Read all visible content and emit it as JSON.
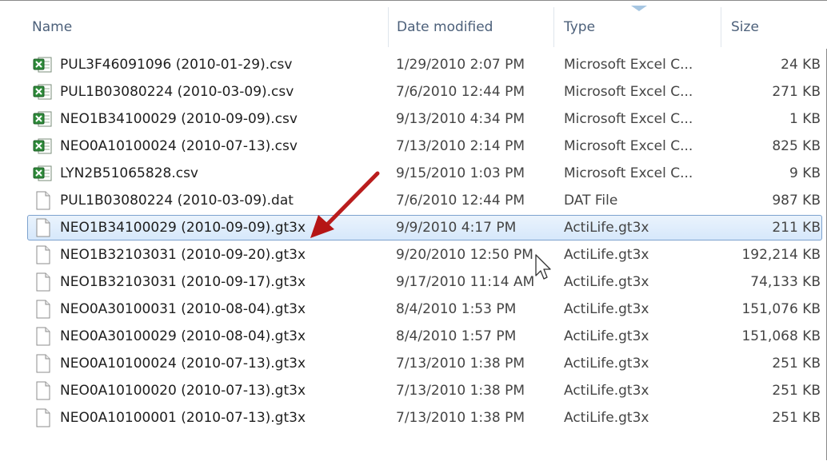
{
  "columns": {
    "name": "Name",
    "date": "Date modified",
    "type": "Type",
    "size": "Size"
  },
  "files": [
    {
      "name": "PUL3F46091096 (2010-01-29).csv",
      "date": "1/29/2010 2:07 PM",
      "type": "Microsoft Excel C...",
      "size": "24 KB",
      "icon": "excel-csv-icon"
    },
    {
      "name": "PUL1B03080224 (2010-03-09).csv",
      "date": "7/6/2010 12:44 PM",
      "type": "Microsoft Excel C...",
      "size": "271 KB",
      "icon": "excel-csv-icon"
    },
    {
      "name": "NEO1B34100029 (2010-09-09).csv",
      "date": "9/13/2010 4:34 PM",
      "type": "Microsoft Excel C...",
      "size": "1 KB",
      "icon": "excel-csv-icon"
    },
    {
      "name": "NEO0A10100024 (2010-07-13).csv",
      "date": "7/13/2010 2:14 PM",
      "type": "Microsoft Excel C...",
      "size": "825 KB",
      "icon": "excel-csv-icon"
    },
    {
      "name": "LYN2B51065828.csv",
      "date": "9/15/2010 1:03 PM",
      "type": "Microsoft Excel C...",
      "size": "9 KB",
      "icon": "excel-csv-icon"
    },
    {
      "name": "PUL1B03080224 (2010-03-09).dat",
      "date": "7/6/2010 12:44 PM",
      "type": "DAT File",
      "size": "987 KB",
      "icon": "blank-file-icon"
    },
    {
      "name": "NEO1B34100029 (2010-09-09).gt3x",
      "date": "9/9/2010 4:17 PM",
      "type": "ActiLife.gt3x",
      "size": "211 KB",
      "icon": "blank-file-icon",
      "selected": true
    },
    {
      "name": "NEO1B32103031 (2010-09-20).gt3x",
      "date": "9/20/2010 12:50 PM",
      "type": "ActiLife.gt3x",
      "size": "192,214 KB",
      "icon": "blank-file-icon"
    },
    {
      "name": "NEO1B32103031 (2010-09-17).gt3x",
      "date": "9/17/2010 11:14 AM",
      "type": "ActiLife.gt3x",
      "size": "74,133 KB",
      "icon": "blank-file-icon"
    },
    {
      "name": "NEO0A30100031 (2010-08-04).gt3x",
      "date": "8/4/2010 1:53 PM",
      "type": "ActiLife.gt3x",
      "size": "151,076 KB",
      "icon": "blank-file-icon"
    },
    {
      "name": "NEO0A30100029 (2010-08-04).gt3x",
      "date": "8/4/2010 1:57 PM",
      "type": "ActiLife.gt3x",
      "size": "151,068 KB",
      "icon": "blank-file-icon"
    },
    {
      "name": "NEO0A10100024 (2010-07-13).gt3x",
      "date": "7/13/2010 1:38 PM",
      "type": "ActiLife.gt3x",
      "size": "251 KB",
      "icon": "blank-file-icon"
    },
    {
      "name": "NEO0A10100020 (2010-07-13).gt3x",
      "date": "7/13/2010 1:38 PM",
      "type": "ActiLife.gt3x",
      "size": "251 KB",
      "icon": "blank-file-icon"
    },
    {
      "name": "NEO0A10100001 (2010-07-13).gt3x",
      "date": "7/13/2010 1:38 PM",
      "type": "ActiLife.gt3x",
      "size": "251 KB",
      "icon": "blank-file-icon"
    }
  ],
  "colors": {
    "header_text": "#4c607a",
    "selection_border": "#7da2ce",
    "annotation_arrow": "#c0181b"
  }
}
